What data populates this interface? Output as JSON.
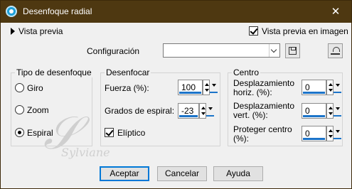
{
  "window": {
    "title": "Desenfoque radial",
    "close_glyph": "✕"
  },
  "top": {
    "preview_toggle_label": "Vista previa",
    "preview_in_image_label": "Vista previa en imagen",
    "preview_in_image_checked": true,
    "configuration_label": "Configuración",
    "configuration_value": ""
  },
  "blur_type": {
    "legend": "Tipo de desenfoque",
    "options": [
      {
        "label": "Giro",
        "checked": false
      },
      {
        "label": "Zoom",
        "checked": false
      },
      {
        "label": "Espiral",
        "checked": true
      }
    ]
  },
  "blur": {
    "legend": "Desenfocar",
    "strength_label": "Fuerza (%):",
    "strength_value": "100",
    "spiral_label": "Grados de espiral:",
    "spiral_value": "-23",
    "elliptic_label": "Elíptico",
    "elliptic_checked": true
  },
  "center": {
    "legend": "Centro",
    "horiz_label_1": "Desplazamiento",
    "horiz_label_2": "horiz. (%):",
    "horiz_value": "0",
    "vert_label_1": "Desplazamiento",
    "vert_label_2": "vert. (%):",
    "vert_value": "0",
    "protect_label_1": "Proteger centro",
    "protect_label_2": "(%):",
    "protect_value": "0"
  },
  "buttons": {
    "ok": "Aceptar",
    "cancel": "Cancelar",
    "help": "Ayuda"
  },
  "watermark": {
    "name": "Sylviane"
  },
  "colors": {
    "titlebar": "#4e3811",
    "accent": "#0078d7",
    "spinner_bar": "#1c74c9"
  }
}
